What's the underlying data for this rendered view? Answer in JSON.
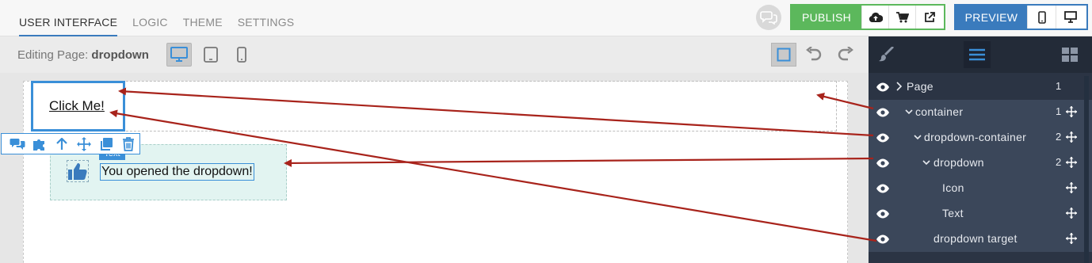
{
  "tabs": [
    {
      "label": "USER INTERFACE",
      "active": true
    },
    {
      "label": "LOGIC",
      "active": false
    },
    {
      "label": "THEME",
      "active": false
    },
    {
      "label": "SETTINGS",
      "active": false
    }
  ],
  "header": {
    "publish_label": "PUBLISH",
    "preview_label": "PREVIEW",
    "publish_color": "#5cb85c",
    "preview_color": "#3a7bbd",
    "publish_icons": [
      "cloud-upload-icon",
      "cart-icon",
      "external-link-icon"
    ],
    "preview_icons": [
      "mobile-icon",
      "desktop-icon"
    ]
  },
  "editbar": {
    "editing_prefix": "Editing Page: ",
    "page_name": "dropdown",
    "devices": [
      "desktop-icon",
      "tablet-icon",
      "mobile-icon"
    ],
    "active_device": "desktop"
  },
  "canvas": {
    "button_text": "Click Me!",
    "text_tag": "Text",
    "dropdown_text": "You opened the dropdown!",
    "toolbar_icons": [
      "comments-icon",
      "puzzle-icon",
      "arrow-up-icon",
      "move-icon",
      "copy-icon",
      "trash-icon"
    ],
    "dropdown_bg": "#e2f4f1",
    "selection_color": "#3a8fd8"
  },
  "panel": {
    "tabs": [
      "paint-brush-icon",
      "layers-icon",
      "grid-icon"
    ],
    "tree": [
      {
        "label": "Page",
        "count": "1",
        "selected": false,
        "chevron": "right"
      },
      {
        "label": "container",
        "count": "1",
        "selected": true,
        "chevron": "down"
      },
      {
        "label": "dropdown-container",
        "count": "2",
        "selected": true,
        "chevron": "down"
      },
      {
        "label": "dropdown",
        "count": "2",
        "selected": true,
        "chevron": "down"
      },
      {
        "label": "Icon",
        "count": "",
        "selected": true,
        "chevron": ""
      },
      {
        "label": "Text",
        "count": "",
        "selected": true,
        "chevron": ""
      },
      {
        "label": "dropdown target",
        "count": "",
        "selected": true,
        "chevron": ""
      }
    ]
  },
  "annotation_arrow_color": "#a8231b"
}
